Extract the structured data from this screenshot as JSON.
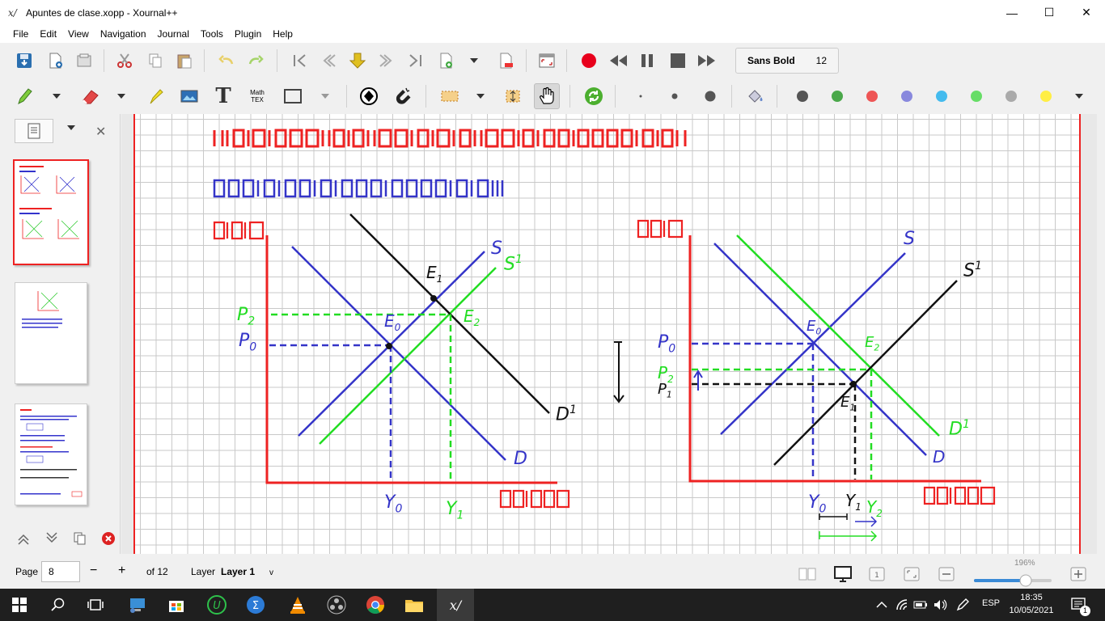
{
  "window": {
    "title": "Apuntes de clase.xopp - Xournal++",
    "icon": "xournal-icon"
  },
  "window_controls": {
    "minimize": "—",
    "maximize": "☐",
    "close": "✕"
  },
  "menu": [
    "File",
    "Edit",
    "View",
    "Navigation",
    "Journal",
    "Tools",
    "Plugin",
    "Help"
  ],
  "toolbar": {
    "font_name": "Sans Bold",
    "font_size": "12",
    "math_label_top": "Math",
    "math_label_bottom": "TEX",
    "text_tool": "T"
  },
  "colors": [
    "#555555",
    "#4aa84a",
    "#ee5555",
    "#8888dd",
    "#44bbee",
    "#66dd66",
    "#aaaaaa",
    "#ffee44"
  ],
  "colors_brand": {
    "accent_red": "#e22222",
    "blue_ink": "#3434c8",
    "green_ink": "#22dd22"
  },
  "canvas": {
    "left_graph": {
      "labels": {
        "p2": "P",
        "p2_sub": "2",
        "p0": "P",
        "p0_sub": "0",
        "s": "S",
        "s1": "S",
        "s1_sup": "1",
        "e1": "E",
        "e1_sub": "1",
        "e0": "E",
        "e0_sub": "0",
        "e2": "E",
        "e2_sub": "2",
        "d": "D",
        "d1": "D",
        "d1_sup": "1",
        "y0": "Y",
        "y0_sub": "0",
        "y1": "Y",
        "y1_sub": "1"
      }
    },
    "right_graph": {
      "labels": {
        "s": "S",
        "s1": "S",
        "s1_sup": "1",
        "p0": "P",
        "p0_sub": "0",
        "p2": "P",
        "p2_sub": "2",
        "p1": "P",
        "p1_sub": "1",
        "e0": "E",
        "e0_sub": "0",
        "e2": "E",
        "e2_sub": "2",
        "e1": "E",
        "e1_sub": "1",
        "d": "D",
        "d1": "D",
        "d1_sup": "1",
        "y0": "Y",
        "y0_sub": "0",
        "y1": "Y",
        "y1_sub": "1",
        "y2": "Y",
        "y2_sub": "2"
      }
    }
  },
  "status": {
    "page_label": "Page",
    "page_value": "8",
    "page_minus": "−",
    "page_plus": "+",
    "page_of": "of 12",
    "layer_label": "Layer",
    "layer_value": "Layer 1",
    "layer_dropdown": "v",
    "zoom": "196%"
  },
  "taskbar": {
    "time": "18:35",
    "date": "10/05/2021",
    "language": "ESP",
    "notification_count": "1"
  }
}
